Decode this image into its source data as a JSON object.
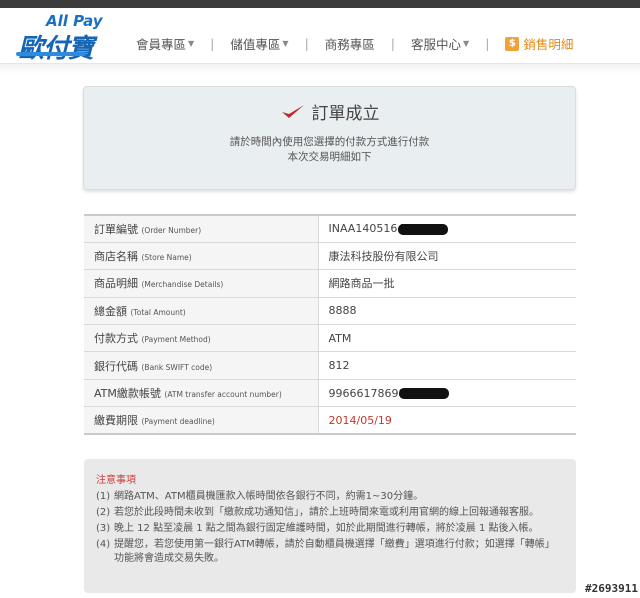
{
  "brand": {
    "logo_en": "All Pay",
    "logo_zh": "歐付寶",
    "color": "#1565b5"
  },
  "nav": {
    "items": [
      {
        "label": "會員專區",
        "dropdown": true
      },
      {
        "label": "儲值專區",
        "dropdown": true
      },
      {
        "label": "商務專區",
        "dropdown": false
      },
      {
        "label": "客服中心",
        "dropdown": true
      }
    ],
    "sales_label": "銷售明細",
    "sales_icon": "dollar-icon",
    "sales_color": "#e28a1a"
  },
  "success": {
    "title": "訂單成立",
    "line1": "請於時間內使用您選擇的付款方式進行付款",
    "line2": "本次交易明細如下"
  },
  "details": {
    "rows": [
      {
        "label": "訂單編號",
        "label_en": "(Order Number)",
        "value": "INAA1405164",
        "redacted": true
      },
      {
        "label": "商店名稱",
        "label_en": "(Store Name)",
        "value": "康法科技股份有限公司"
      },
      {
        "label": "商品明細",
        "label_en": "(Merchandise Details)",
        "value": "網路商品一批"
      },
      {
        "label": "總金額",
        "label_en": "(Total Amount)",
        "value": "8888"
      },
      {
        "label": "付款方式",
        "label_en": "(Payment Method)",
        "value": "ATM"
      },
      {
        "label": "銀行代碼",
        "label_en": "(Bank SWIFT code)",
        "value": "812"
      },
      {
        "label": "ATM繳款帳號",
        "label_en": "(ATM transfer account number)",
        "value": "99666178698",
        "redacted": true
      },
      {
        "label": "繳費期限",
        "label_en": "(Payment deadline)",
        "value": "2014/05/19",
        "highlight": true
      }
    ]
  },
  "notice": {
    "title": "注意事項",
    "items": [
      {
        "num": "(1)",
        "text": "網路ATM、ATM櫃員機匯款入帳時間依各銀行不同，約需1~30分鐘。"
      },
      {
        "num": "(2)",
        "text": "若您於此段時間未收到「繳款成功通知信」，請於上班時間來電或利用官網的線上回報通報客服。"
      },
      {
        "num": "(3)",
        "text": "晚上 12 點至凌晨 1 點之間為銀行固定維護時間，如於此期間進行轉帳，將於凌晨 1 點後入帳。"
      },
      {
        "num": "(4)",
        "text": "提醒您，若您使用第一銀行ATM轉帳，請於自動櫃員機選擇「繳費」選項進行付款；如選擇「轉帳」功能將會造成交易失敗。"
      }
    ]
  },
  "watermark": "#2693911"
}
